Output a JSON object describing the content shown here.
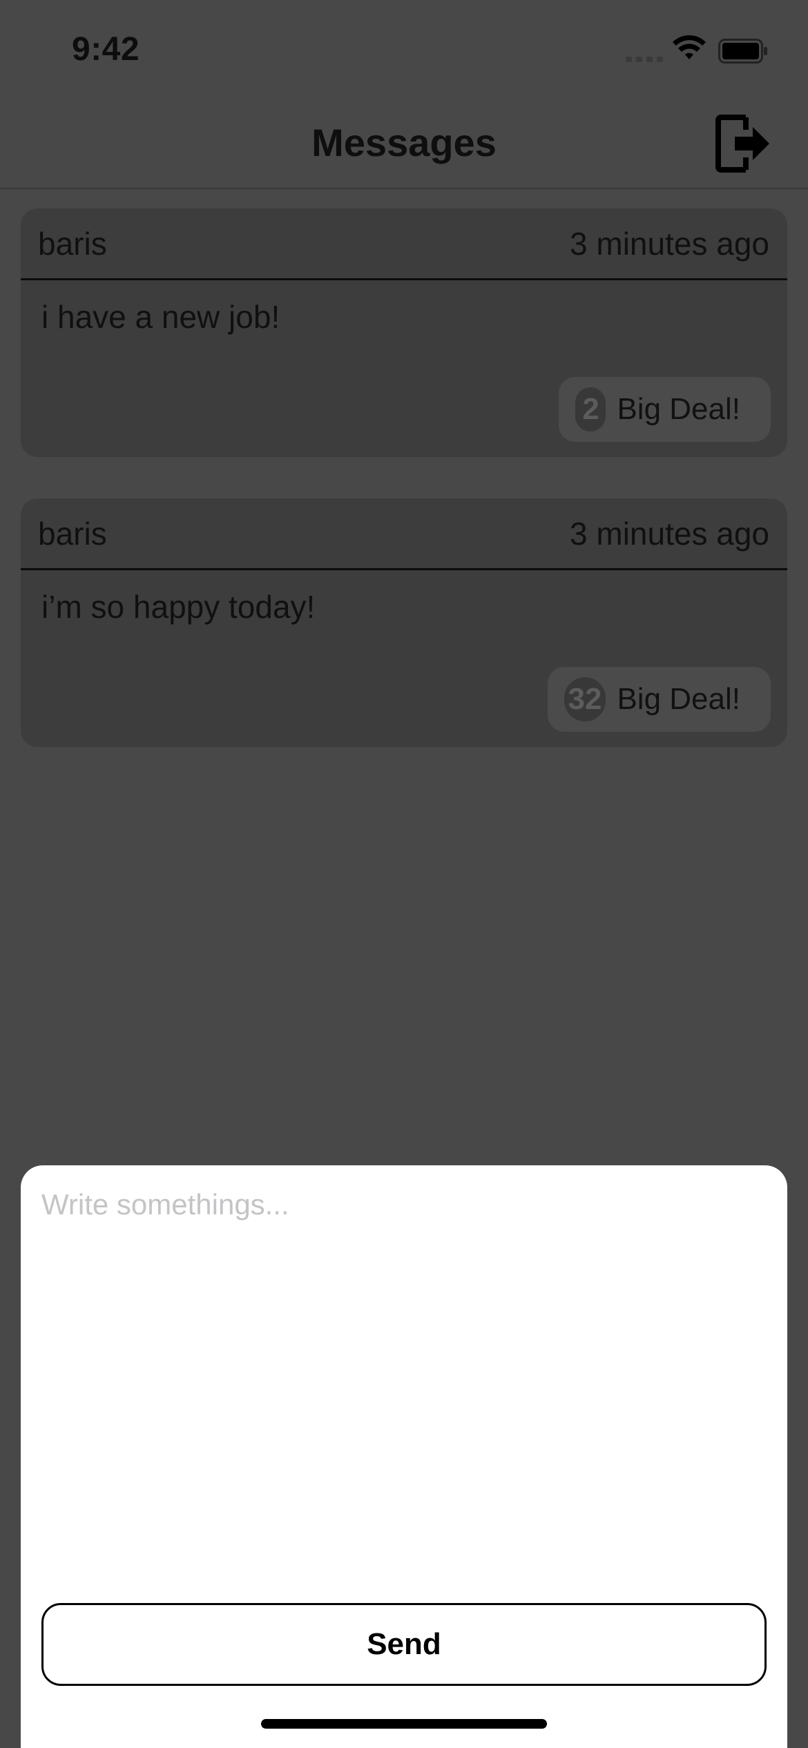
{
  "status_bar": {
    "time": "9:42"
  },
  "header": {
    "title": "Messages",
    "logout_icon": "logout-icon"
  },
  "messages": [
    {
      "author": "baris",
      "time": "3 minutes ago",
      "text": "i have a new job!",
      "deal_count": "2",
      "deal_label": "Big Deal!"
    },
    {
      "author": "baris",
      "time": "3 minutes ago",
      "text": "i’m so happy today!",
      "deal_count": "32",
      "deal_label": "Big Deal!"
    }
  ],
  "compose": {
    "placeholder": "Write somethings...",
    "value": "",
    "send_label": "Send"
  },
  "colors": {
    "background": "#484848",
    "card": "#3d3d3d",
    "sheet": "#ffffff",
    "button_border": "#000000"
  }
}
